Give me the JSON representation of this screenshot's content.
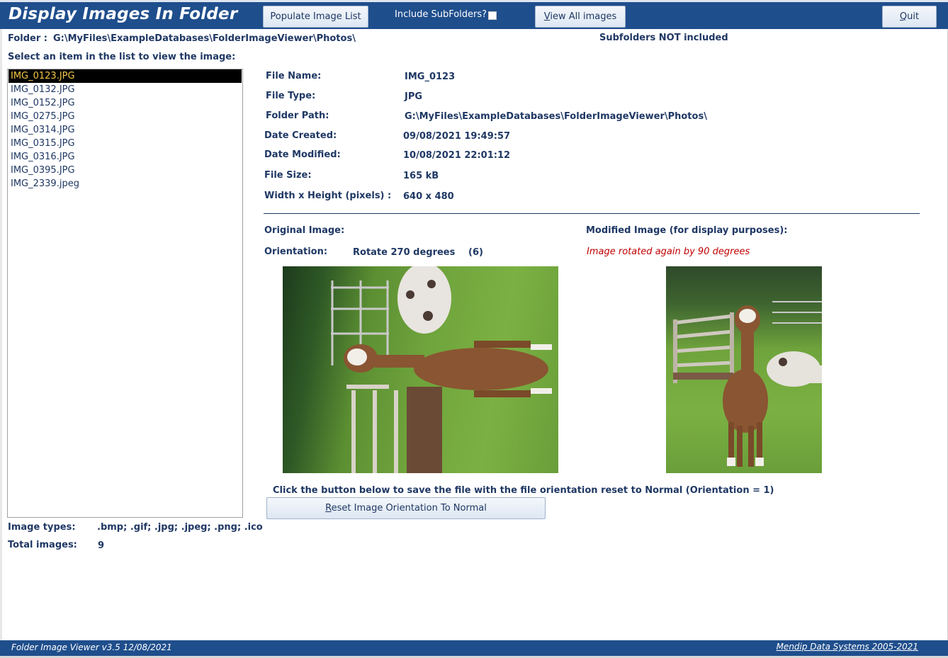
{
  "header": {
    "title": "Display Images In Folder",
    "populate_label": "Populate Image List",
    "include_subfolders_label": "Include SubFolders?",
    "include_subfolders_checked": false,
    "view_all_prefix": "V",
    "view_all_rest": "iew All images",
    "quit_prefix": "Q",
    "quit_rest": "uit"
  },
  "folder": {
    "label": "Folder :",
    "path": "G:\\MyFiles\\ExampleDatabases\\FolderImageViewer\\Photos\\",
    "subfolder_status": "Subfolders NOT included"
  },
  "instruction": "Select an item in the list to view the image:",
  "file_list": [
    "IMG_0123.JPG",
    "IMG_0132.JPG",
    "IMG_0152.JPG",
    "IMG_0275.JPG",
    "IMG_0314.JPG",
    "IMG_0315.JPG",
    "IMG_0316.JPG",
    "IMG_0395.JPG",
    "IMG_2339.jpeg"
  ],
  "selected_index": 0,
  "summary": {
    "image_types_label": "Image types:",
    "image_types_value": ".bmp; .gif; .jpg; .jpeg; .png; .ico",
    "total_images_label": "Total images:",
    "total_images_value": "9"
  },
  "details": {
    "file_name_label": "File Name:",
    "file_name_value": "IMG_0123",
    "file_type_label": "File Type:",
    "file_type_value": "JPG",
    "folder_path_label": "Folder Path:",
    "folder_path_value": "G:\\MyFiles\\ExampleDatabases\\FolderImageViewer\\Photos\\",
    "date_created_label": "Date Created:",
    "date_created_value": "09/08/2021 19:49:57",
    "date_modified_label": "Date Modified:",
    "date_modified_value": "10/08/2021 22:01:12",
    "file_size_label": "File Size:",
    "file_size_value": "165 kB",
    "dimensions_label": "Width x Height (pixels) :",
    "dimensions_value": "640 x 480"
  },
  "images": {
    "original_label": "Original Image:",
    "modified_label": "Modified Image  (for display purposes):",
    "orientation_label": "Orientation:",
    "orientation_value": "Rotate 270 degrees",
    "orientation_code": "(6)",
    "rotation_note": "Image rotated again by 90 degrees"
  },
  "reset": {
    "instruction": "Click the button below to save the file with the file orientation reset to Normal (Orientation = 1)",
    "button_prefix": "R",
    "button_rest": "eset Image Orientation To Normal"
  },
  "footer": {
    "version": "Folder Image Viewer  v3.5  12/08/2021",
    "credit": "Mendip Data Systems 2005-2021"
  },
  "colors": {
    "header_bg": "#1f4e8c",
    "text": "#1f3864",
    "selected_bg": "#000000",
    "selected_text": "#f2c744",
    "note_red": "#c00000"
  }
}
